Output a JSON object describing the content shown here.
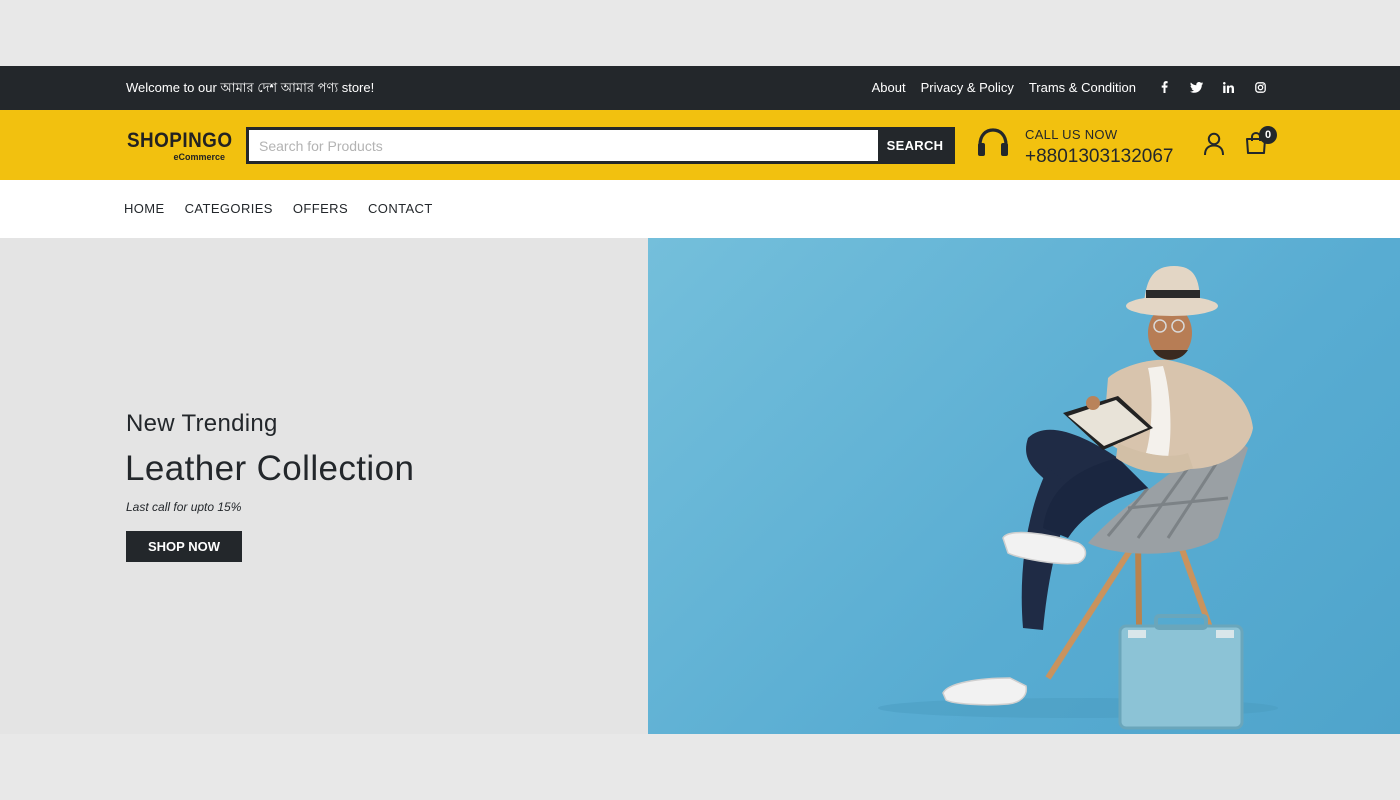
{
  "topbar": {
    "welcome": "Welcome to our আমার দেশ আমার পণ্য store!",
    "links": [
      "About",
      "Privacy & Policy",
      "Trams & Condition"
    ],
    "social": [
      "f",
      "t",
      "in",
      "ig"
    ]
  },
  "header": {
    "logo_brand": "SHOPINGO",
    "logo_sub": "eCommerce",
    "search_placeholder": "Search for Products",
    "search_button": "SEARCH",
    "call_label": "CALL US NOW",
    "call_phone": "+8801303132067",
    "cart_count": "0"
  },
  "nav": {
    "items": [
      "HOME",
      "CATEGORIES",
      "OFFERS",
      "CONTACT"
    ]
  },
  "hero": {
    "kicker": "New Trending",
    "headline": "Leather Collection",
    "tagline": "Last call for upto 15%",
    "cta": "SHOP NOW",
    "image_icon": "man-on-chair-photo"
  },
  "colors": {
    "accent": "#f2c10f",
    "dark": "#23272b",
    "hero_bg": "#e4e4e4",
    "photo_bg": "#5cb1d6"
  }
}
